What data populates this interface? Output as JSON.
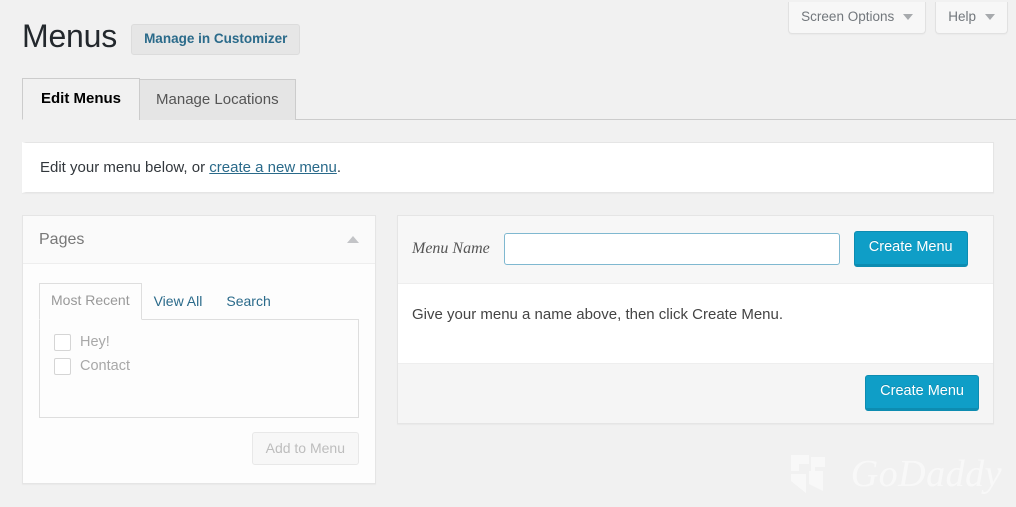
{
  "screen_meta": {
    "screen_options_label": "Screen Options",
    "help_label": "Help"
  },
  "header": {
    "page_title": "Menus",
    "customizer_button": "Manage in Customizer"
  },
  "nav_tabs": [
    {
      "label": "Edit Menus",
      "active": true
    },
    {
      "label": "Manage Locations",
      "active": false
    }
  ],
  "notice": {
    "text_before": "Edit your menu below, or ",
    "link_text": "create a new menu",
    "text_after": "."
  },
  "pages_panel": {
    "title": "Pages",
    "toggle_icon": "caret-up-icon",
    "tabs": [
      {
        "label": "Most Recent",
        "active": true
      },
      {
        "label": "View All",
        "active": false
      },
      {
        "label": "Search",
        "active": false
      }
    ],
    "items": [
      {
        "label": "Hey!",
        "checked": false
      },
      {
        "label": "Contact",
        "checked": false
      }
    ],
    "add_to_menu_label": "Add to Menu",
    "add_to_menu_disabled": true
  },
  "menu_panel": {
    "menu_name_label": "Menu Name",
    "menu_name_value": "",
    "menu_name_placeholder": "",
    "create_menu_label": "Create Menu",
    "instructions": "Give your menu a name above, then click Create Menu.",
    "footer_create_menu_label": "Create Menu"
  },
  "watermark": {
    "text": "GoDaddy"
  },
  "colors": {
    "accent_blue": "#0f9ec7",
    "link_blue": "#2a6a8a",
    "page_bg": "#f1f1f1",
    "panel_bg": "#ffffff",
    "muted_text": "#a8a8a8"
  }
}
